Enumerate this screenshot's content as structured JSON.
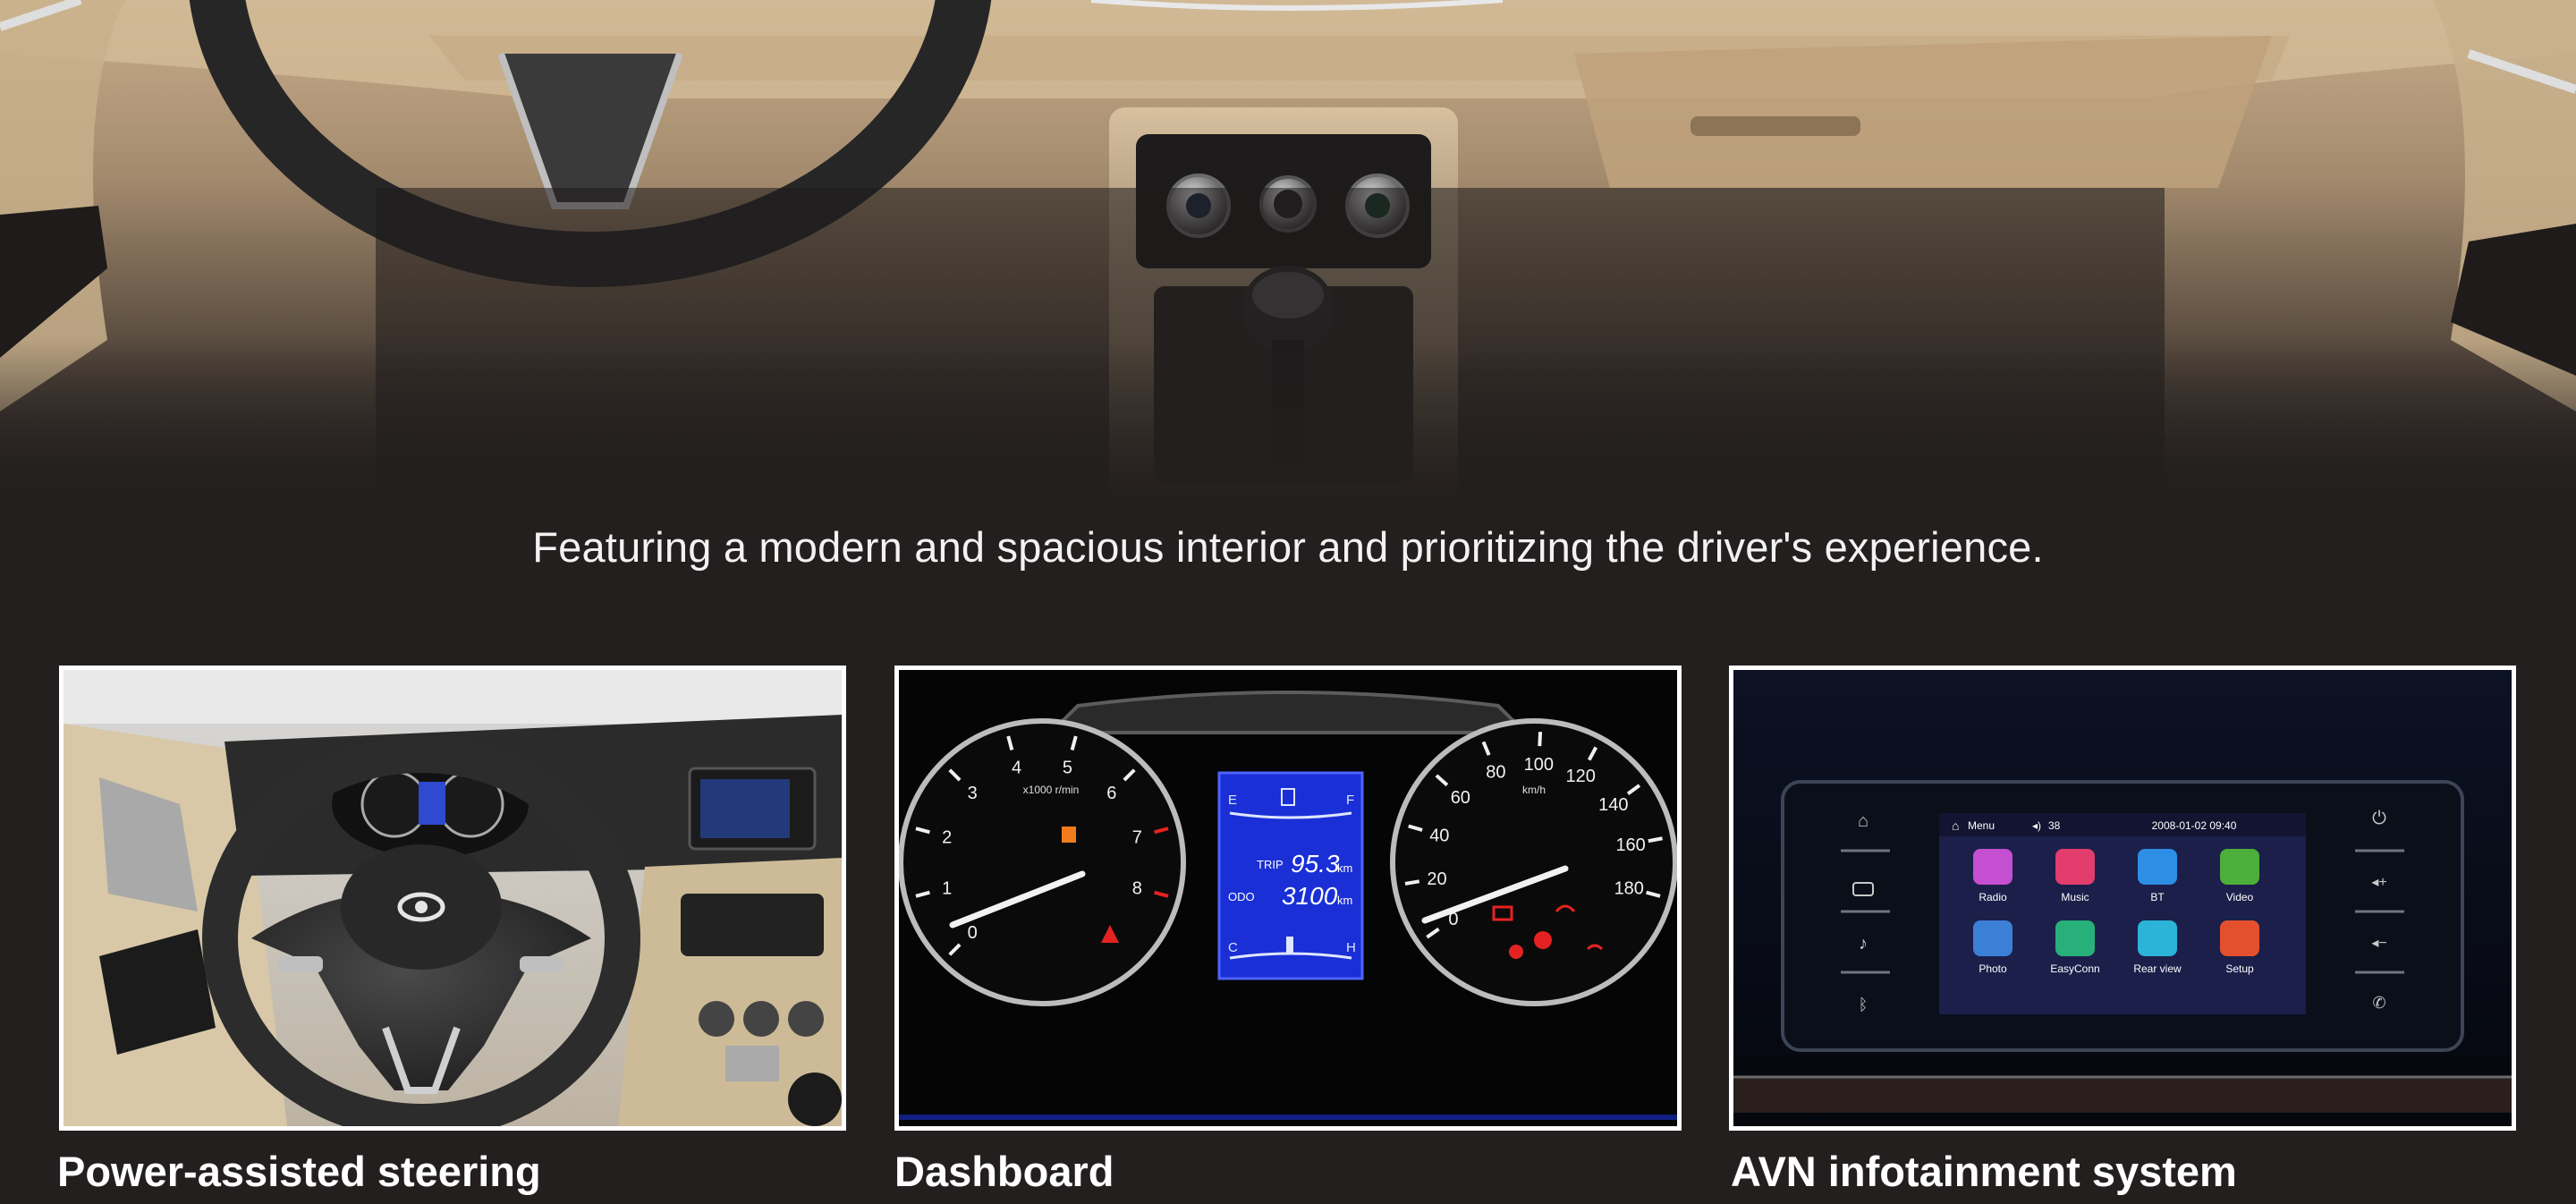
{
  "tagline": "Featuring a modern and spacious interior and prioritizing the driver's experience.",
  "features": [
    {
      "title": "Power-assisted steering"
    },
    {
      "title": "Dashboard"
    },
    {
      "title": "AVN infotainment system"
    }
  ],
  "dashboard": {
    "tach_labels": [
      "0",
      "1",
      "2",
      "3",
      "4",
      "5",
      "6",
      "7",
      "8"
    ],
    "tach_unit": "x1000 r/min",
    "speed_labels": [
      "0",
      "20",
      "40",
      "60",
      "80",
      "100",
      "120",
      "140",
      "160",
      "180"
    ],
    "speed_unit": "km/h",
    "lcd": {
      "fuel_empty": "E",
      "fuel_full": "F",
      "trip_label": "TRIP",
      "trip_value": "95.3",
      "odo_label": "ODO",
      "odo_value": "3100",
      "unit": "km",
      "temp_cold": "C",
      "temp_hot": "H"
    }
  },
  "infotainment": {
    "menu_label": "Menu",
    "volume": "38",
    "datetime": "2008-01-02 09:40",
    "apps": [
      {
        "label": "Radio",
        "color": "#c44fd0"
      },
      {
        "label": "Music",
        "color": "#e23d6d"
      },
      {
        "label": "BT",
        "color": "#2d8ee6"
      },
      {
        "label": "Video",
        "color": "#4caf3b"
      },
      {
        "label": "Photo",
        "color": "#3c7fd6"
      },
      {
        "label": "EasyConn",
        "color": "#27b07a"
      },
      {
        "label": "Rear view",
        "color": "#2bb3d8"
      },
      {
        "label": "Setup",
        "color": "#e4502e"
      }
    ]
  },
  "colors": {
    "background": "#231f1f",
    "card_border": "#ffffff",
    "text": "#ffffff",
    "lcd_blue": "#1a2fd6"
  }
}
